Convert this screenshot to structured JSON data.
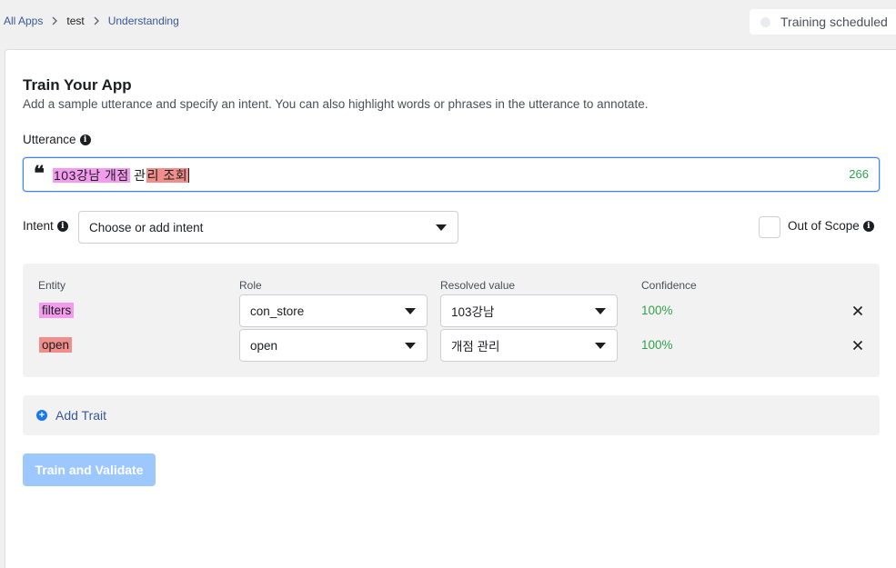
{
  "breadcrumb": {
    "all_apps": "All Apps",
    "app": "test",
    "section": "Understanding"
  },
  "status": {
    "text": "Training scheduled"
  },
  "page": {
    "title": "Train Your App",
    "subtitle": "Add a sample utterance and specify an intent. You can also highlight words or phrases in the utterance to annotate."
  },
  "utterance": {
    "label": "Utterance",
    "quote_glyph": "❝",
    "segments": [
      "103강남 개점",
      " ",
      "관",
      "리 조회"
    ],
    "char_count": "266"
  },
  "intent": {
    "label": "Intent",
    "placeholder": "Choose or add intent"
  },
  "out_of_scope": {
    "label": "Out of Scope",
    "checked": false
  },
  "entities": {
    "headers": {
      "entity": "Entity",
      "role": "Role",
      "resolved": "Resolved value",
      "confidence": "Confidence"
    },
    "rows": [
      {
        "entity": "filters",
        "role": "con_store",
        "resolved": "103강남",
        "confidence": "100%",
        "color": "#f39ced"
      },
      {
        "entity": "open",
        "role": "open",
        "resolved": "개점 관리",
        "confidence": "100%",
        "color": "#ef8e8a"
      }
    ]
  },
  "trait": {
    "label": "Add Trait"
  },
  "actions": {
    "train_label": "Train and Validate"
  },
  "colors": {
    "accent": "#1877f2",
    "link": "#385898",
    "success": "#31a24c",
    "button_disabled": "#9cc7ff"
  }
}
